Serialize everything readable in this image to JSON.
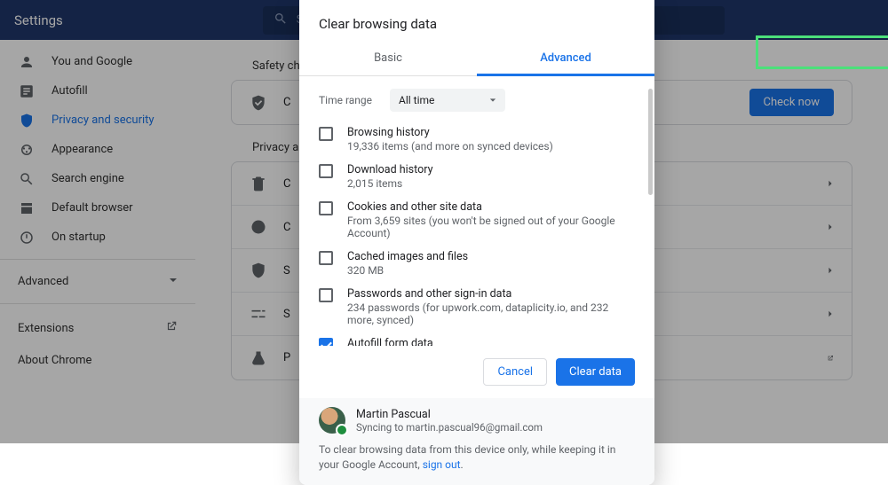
{
  "topbar": {
    "title": "Settings",
    "searchPlaceholder": "Se"
  },
  "sidebar": {
    "items": [
      {
        "label": "You and Google"
      },
      {
        "label": "Autofill"
      },
      {
        "label": "Privacy and security"
      },
      {
        "label": "Appearance"
      },
      {
        "label": "Search engine"
      },
      {
        "label": "Default browser"
      },
      {
        "label": "On startup"
      }
    ],
    "advanced": "Advanced",
    "extensions": "Extensions",
    "about": "About Chrome"
  },
  "main": {
    "safetyTitle": "Safety ch",
    "safetyRow": "C",
    "checkNow": "Check now",
    "privacyTitle": "Privacy a",
    "rows": [
      {
        "t": "C"
      },
      {
        "t": "C"
      },
      {
        "t": "S"
      },
      {
        "t": "S"
      },
      {
        "t": "P"
      }
    ]
  },
  "dialog": {
    "title": "Clear browsing data",
    "tabs": {
      "basic": "Basic",
      "advanced": "Advanced"
    },
    "timeRangeLabel": "Time range",
    "timeRangeValue": "All time",
    "options": [
      {
        "title": "Browsing history",
        "sub": "19,336 items (and more on synced devices)",
        "checked": false
      },
      {
        "title": "Download history",
        "sub": "2,015 items",
        "checked": false
      },
      {
        "title": "Cookies and other site data",
        "sub": "From 3,659 sites (you won't be signed out of your Google Account)",
        "checked": false
      },
      {
        "title": "Cached images and files",
        "sub": "320 MB",
        "checked": false
      },
      {
        "title": "Passwords and other sign-in data",
        "sub": "234 passwords (for upwork.com, dataplicity.io, and 232 more, synced)",
        "checked": false
      },
      {
        "title": "Autofill form data",
        "sub": "",
        "checked": true
      }
    ],
    "cancel": "Cancel",
    "clear": "Clear data",
    "user": {
      "name": "Martin Pascual",
      "syncing": "Syncing to martin.pascual96@gmail.com"
    },
    "footnote1": "To clear browsing data from this device only, while keeping it in your Google Account, ",
    "footnoteLink": "sign out",
    "footnote2": "."
  }
}
